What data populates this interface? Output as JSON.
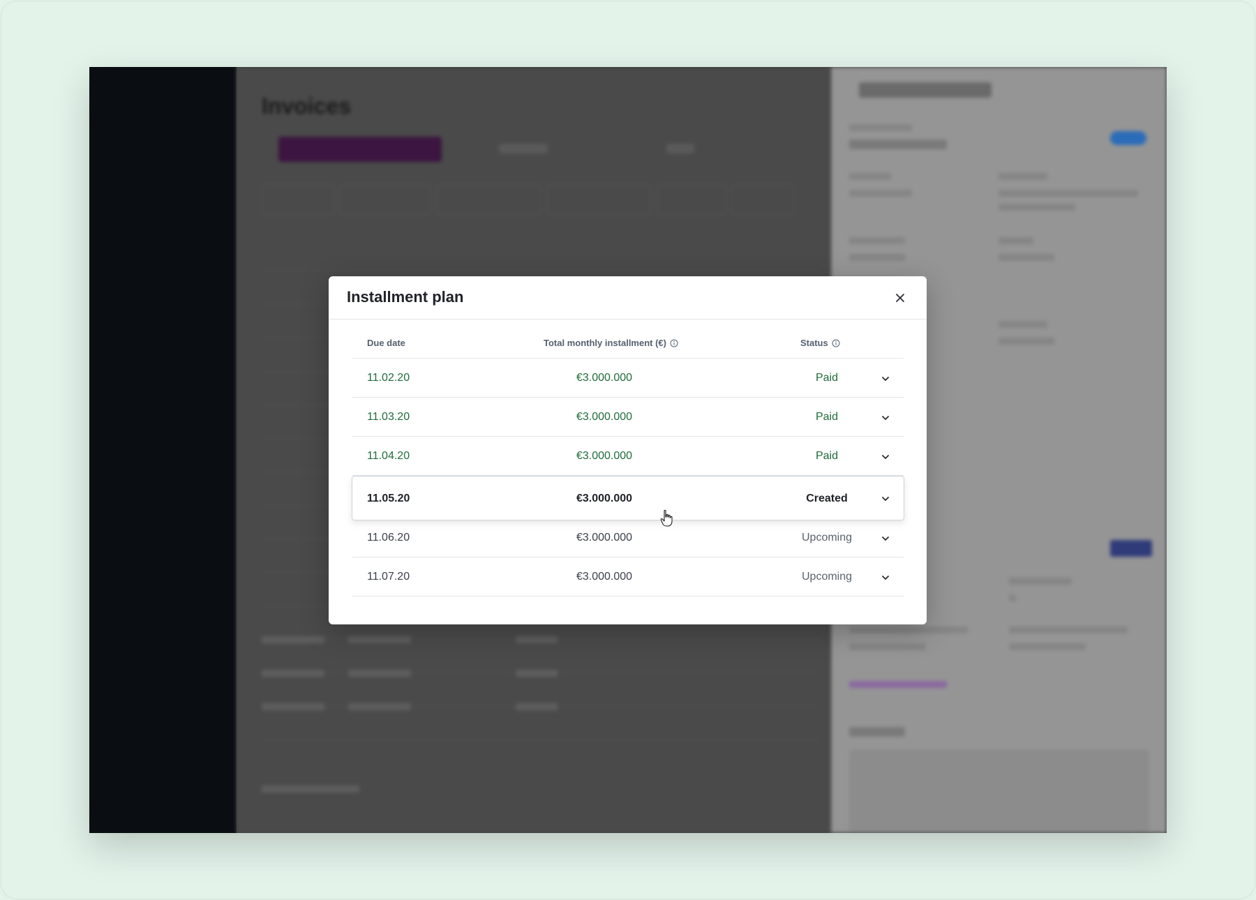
{
  "modal": {
    "title": "Installment plan",
    "close_icon": "close-icon",
    "columns": {
      "due_date": "Due date",
      "total": "Total monthly installment (€)",
      "status": "Status"
    },
    "rows": [
      {
        "due": "11.02.20",
        "amount": "€3.000.000",
        "status": "Paid"
      },
      {
        "due": "11.03.20",
        "amount": "€3.000.000",
        "status": "Paid"
      },
      {
        "due": "11.04.20",
        "amount": "€3.000.000",
        "status": "Paid"
      },
      {
        "due": "11.05.20",
        "amount": "€3.000.000",
        "status": "Created"
      },
      {
        "due": "11.06.20",
        "amount": "€3.000.000",
        "status": "Upcoming"
      },
      {
        "due": "11.07.20",
        "amount": "€3.000.000",
        "status": "Upcoming"
      }
    ]
  },
  "colors": {
    "paid_green": "#1e6b3a",
    "background": "#e3f3ea",
    "sidebar": "#0a0e12"
  },
  "background_page": {
    "heading": "Invoices"
  }
}
